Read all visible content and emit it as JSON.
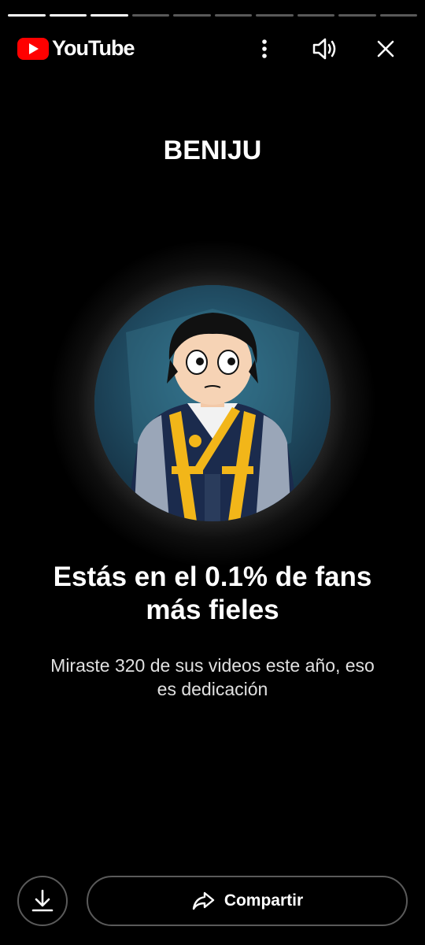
{
  "progress": {
    "total_segments": 10,
    "completed_segments": 3
  },
  "header": {
    "app_name": "YouTube",
    "icons": [
      "more-vert-icon",
      "volume-icon",
      "close-icon"
    ]
  },
  "story": {
    "channel_name": "BENIJU",
    "headline_line1": "Estás en el 0.1% de fans",
    "headline_line2": "más fieles",
    "subtext_line1": "Miraste 320 de sus videos este año, eso",
    "subtext_line2": "es dedicación"
  },
  "actions": {
    "share_label": "Compartir"
  },
  "colors": {
    "background": "#000000",
    "youtube_red": "#ff0000",
    "button_border": "#5a5a5a"
  }
}
